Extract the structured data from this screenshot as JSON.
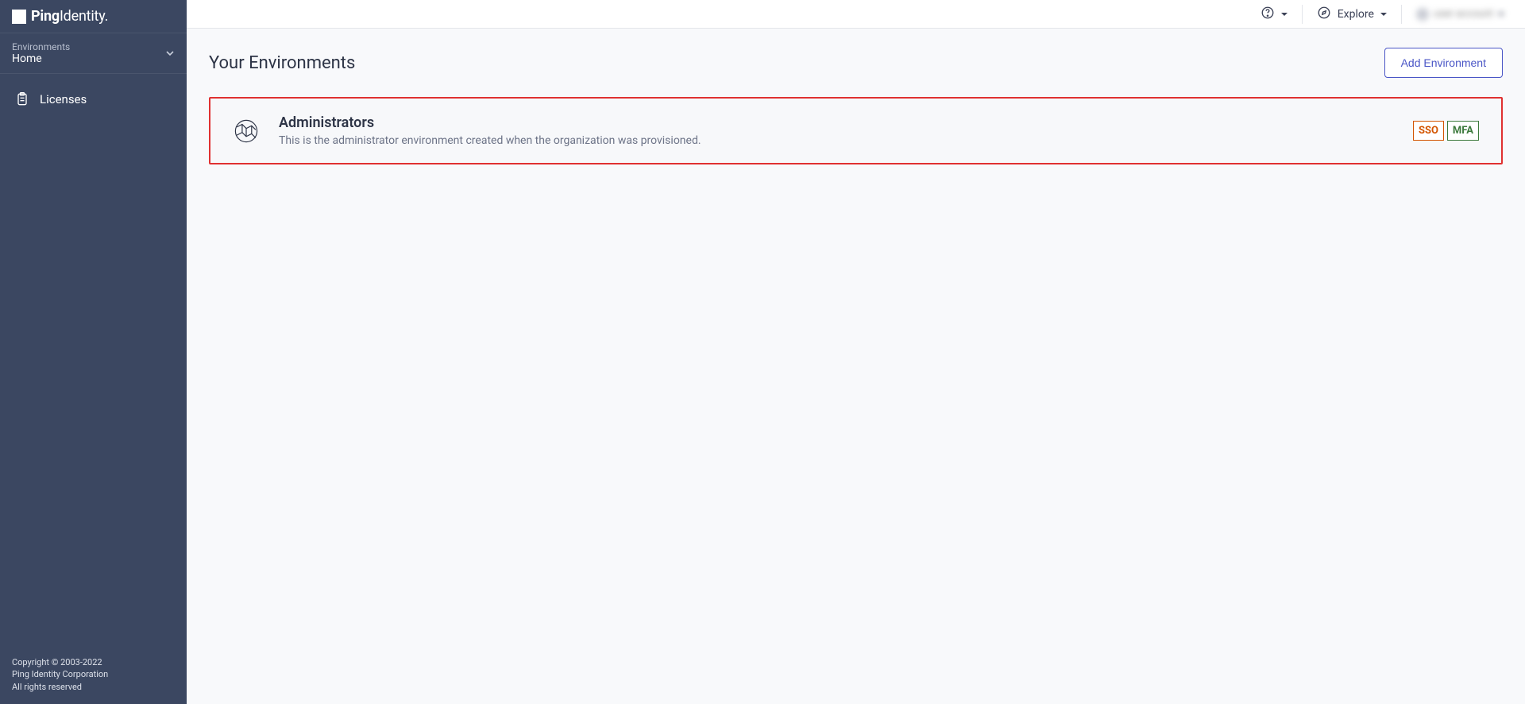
{
  "brand": {
    "name_bold": "Ping",
    "name_rest": "Identity."
  },
  "sidebar": {
    "env_label": "Environments",
    "env_value": "Home",
    "items": [
      {
        "label": "Licenses"
      }
    ],
    "footer": {
      "copyright": "Copyright © 2003-2022",
      "company": "Ping Identity Corporation",
      "rights": "All rights reserved"
    }
  },
  "topbar": {
    "explore": "Explore",
    "user_name": "user account"
  },
  "page": {
    "title": "Your Environments",
    "add_button": "Add Environment"
  },
  "environments": [
    {
      "title": "Administrators",
      "description": "This is the administrator environment created when the organization was provisioned.",
      "badges": {
        "sso": "SSO",
        "mfa": "MFA"
      }
    }
  ]
}
